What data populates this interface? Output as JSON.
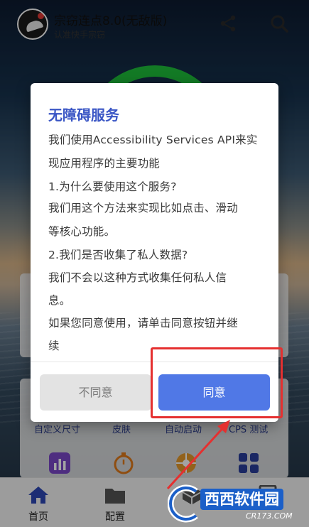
{
  "header": {
    "title": "宗窃连点8.0(无敌版)",
    "subtitle": "认准快手宗窃",
    "share_icon": "share-icon",
    "search_icon": "search-icon"
  },
  "colors": {
    "ring": "#1fbf3b",
    "dialog_title": "#3a56c5",
    "agree_button": "#5078e6",
    "disagree_button": "#e3e3e3",
    "annotation": "#e53030"
  },
  "features": {
    "labels": [
      "自定义尺寸",
      "皮肤",
      "自动启动",
      "CPS 测试"
    ],
    "icons": [
      "bar-chart-icon",
      "stopwatch-icon",
      "wheel-icon",
      "grid-icon"
    ]
  },
  "bottom_nav": {
    "items": [
      {
        "label": "首页",
        "icon": "home-icon",
        "active": true
      },
      {
        "label": "配置",
        "icon": "folder-icon",
        "active": false
      },
      {
        "label": "",
        "icon": "cube-icon",
        "active": false
      },
      {
        "label": "",
        "icon": "document-icon",
        "active": false
      }
    ]
  },
  "dialog": {
    "title": "无障碍服务",
    "lines": [
      "我们使用Accessibility Services API来实",
      "现应用程序的主要功能",
      "1.为什么要使用这个服务?",
      "我们用这个方法来实现比如点击、滑动",
      "等核心功能。",
      "2.我们是否收集了私人数据?",
      "我们不会以这种方式收集任何私人信",
      "息。",
      "如果您同意使用，请单击同意按钮并继",
      "续"
    ],
    "disagree_label": "不同意",
    "agree_label": "同意"
  },
  "watermark": {
    "title": "西西软件园",
    "domain": "CR173.COM"
  }
}
